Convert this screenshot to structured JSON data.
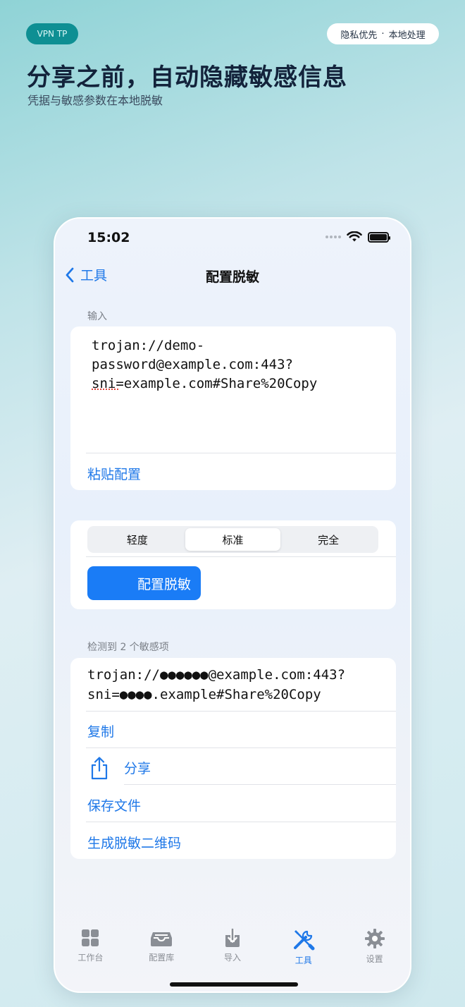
{
  "badge": {
    "brand": "VPN TP",
    "privacy_left": "隐私优先",
    "privacy_dot": "·",
    "privacy_right": "本地处理"
  },
  "hero": {
    "title": "分享之前，自动隐藏敏感信息",
    "subtitle": "凭据与敏感参数在本地脱敏"
  },
  "status": {
    "time": "15:02"
  },
  "nav": {
    "back_label": "工具",
    "title": "配置脱敏"
  },
  "input_section": {
    "label": "输入",
    "value": "trojan://demo-\npassword@example.com:443?\nsni=example.com#Share%20Copy",
    "paste_label": "粘贴配置"
  },
  "level": {
    "options": [
      "轻度",
      "标准",
      "完全"
    ],
    "selected": "标准",
    "action_label": "配置脱敏"
  },
  "result_section": {
    "label": "检测到 2 个敏感项",
    "value": "trojan://●●●●●●@example.com:443?\nsni=●●●●.example#Share%20Copy",
    "actions": {
      "copy": "复制",
      "share": "分享",
      "save": "保存文件",
      "qr": "生成脱敏二维码"
    }
  },
  "tabbar": {
    "items": [
      {
        "label": "工作台",
        "icon": "grid-icon"
      },
      {
        "label": "配置库",
        "icon": "tray-icon"
      },
      {
        "label": "导入",
        "icon": "download-icon"
      },
      {
        "label": "工具",
        "icon": "tools-icon"
      },
      {
        "label": "设置",
        "icon": "gear-icon"
      }
    ],
    "active": "工具"
  },
  "colors": {
    "accent": "#1f78e8",
    "brand_pill": "#0e8f93",
    "primary_button": "#1a7cf6"
  }
}
